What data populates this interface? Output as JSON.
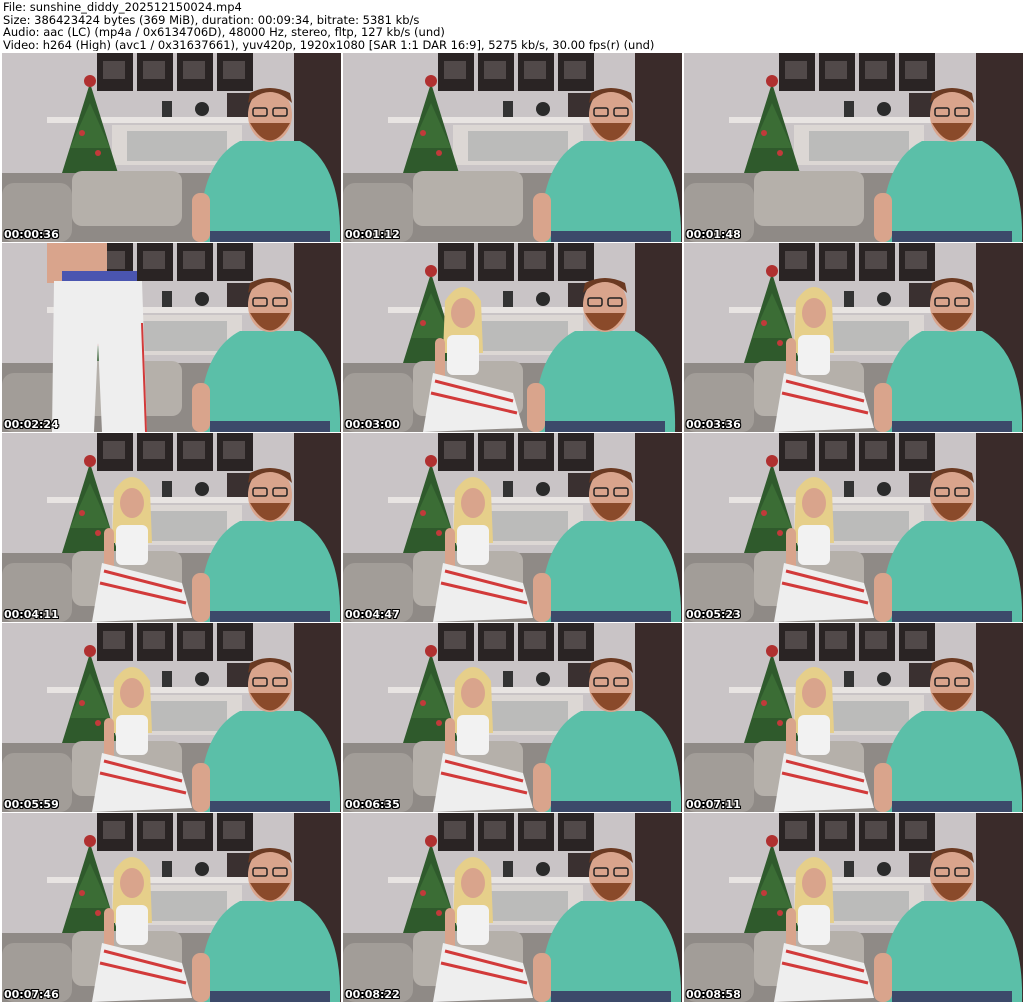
{
  "header": {
    "file_line": "File: sunshine_diddy_202512150024.mp4",
    "size_line": "Size: 386423424 bytes (369 MiB), duration: 00:09:34, bitrate: 5381 kb/s",
    "audio_line": "Audio: aac (LC) (mp4a / 0x6134706D), 48000 Hz, stereo, fltp, 127 kb/s (und)",
    "video_line": "Video: h264 (High) (avc1 / 0x31637661), yuv420p, 1920x1080 [SAR 1:1 DAR 16:9], 5275 kb/s, 30.00 fps(r) (und)"
  },
  "colors": {
    "wall": "#c9c4c6",
    "wall_dark": "#5a4d4c",
    "curtain": "#3a2b2a",
    "map_frame": "#2a2424",
    "couch": "#8f8a86",
    "cushion": "#b5b0aa",
    "shirt": "#5bbfa8",
    "skin": "#d9a48c",
    "beard": "#8a4a2a",
    "tree": "#2f5a2c",
    "pants_white": "#eeeeee",
    "pants_stripe": "#d23a3a",
    "hair_blonde": "#e6cf8a",
    "jeans": "#3c4a6a"
  },
  "thumbnails": [
    {
      "time": "00:00:36",
      "scene": "man"
    },
    {
      "time": "00:01:12",
      "scene": "man"
    },
    {
      "time": "00:01:48",
      "scene": "man"
    },
    {
      "time": "00:02:24",
      "scene": "standing"
    },
    {
      "time": "00:03:00",
      "scene": "woman-side"
    },
    {
      "time": "00:03:36",
      "scene": "woman"
    },
    {
      "time": "00:04:11",
      "scene": "woman"
    },
    {
      "time": "00:04:47",
      "scene": "woman"
    },
    {
      "time": "00:05:23",
      "scene": "woman"
    },
    {
      "time": "00:05:59",
      "scene": "woman"
    },
    {
      "time": "00:06:35",
      "scene": "woman"
    },
    {
      "time": "00:07:11",
      "scene": "woman"
    },
    {
      "time": "00:07:46",
      "scene": "woman"
    },
    {
      "time": "00:08:22",
      "scene": "woman"
    },
    {
      "time": "00:08:58",
      "scene": "woman"
    }
  ]
}
